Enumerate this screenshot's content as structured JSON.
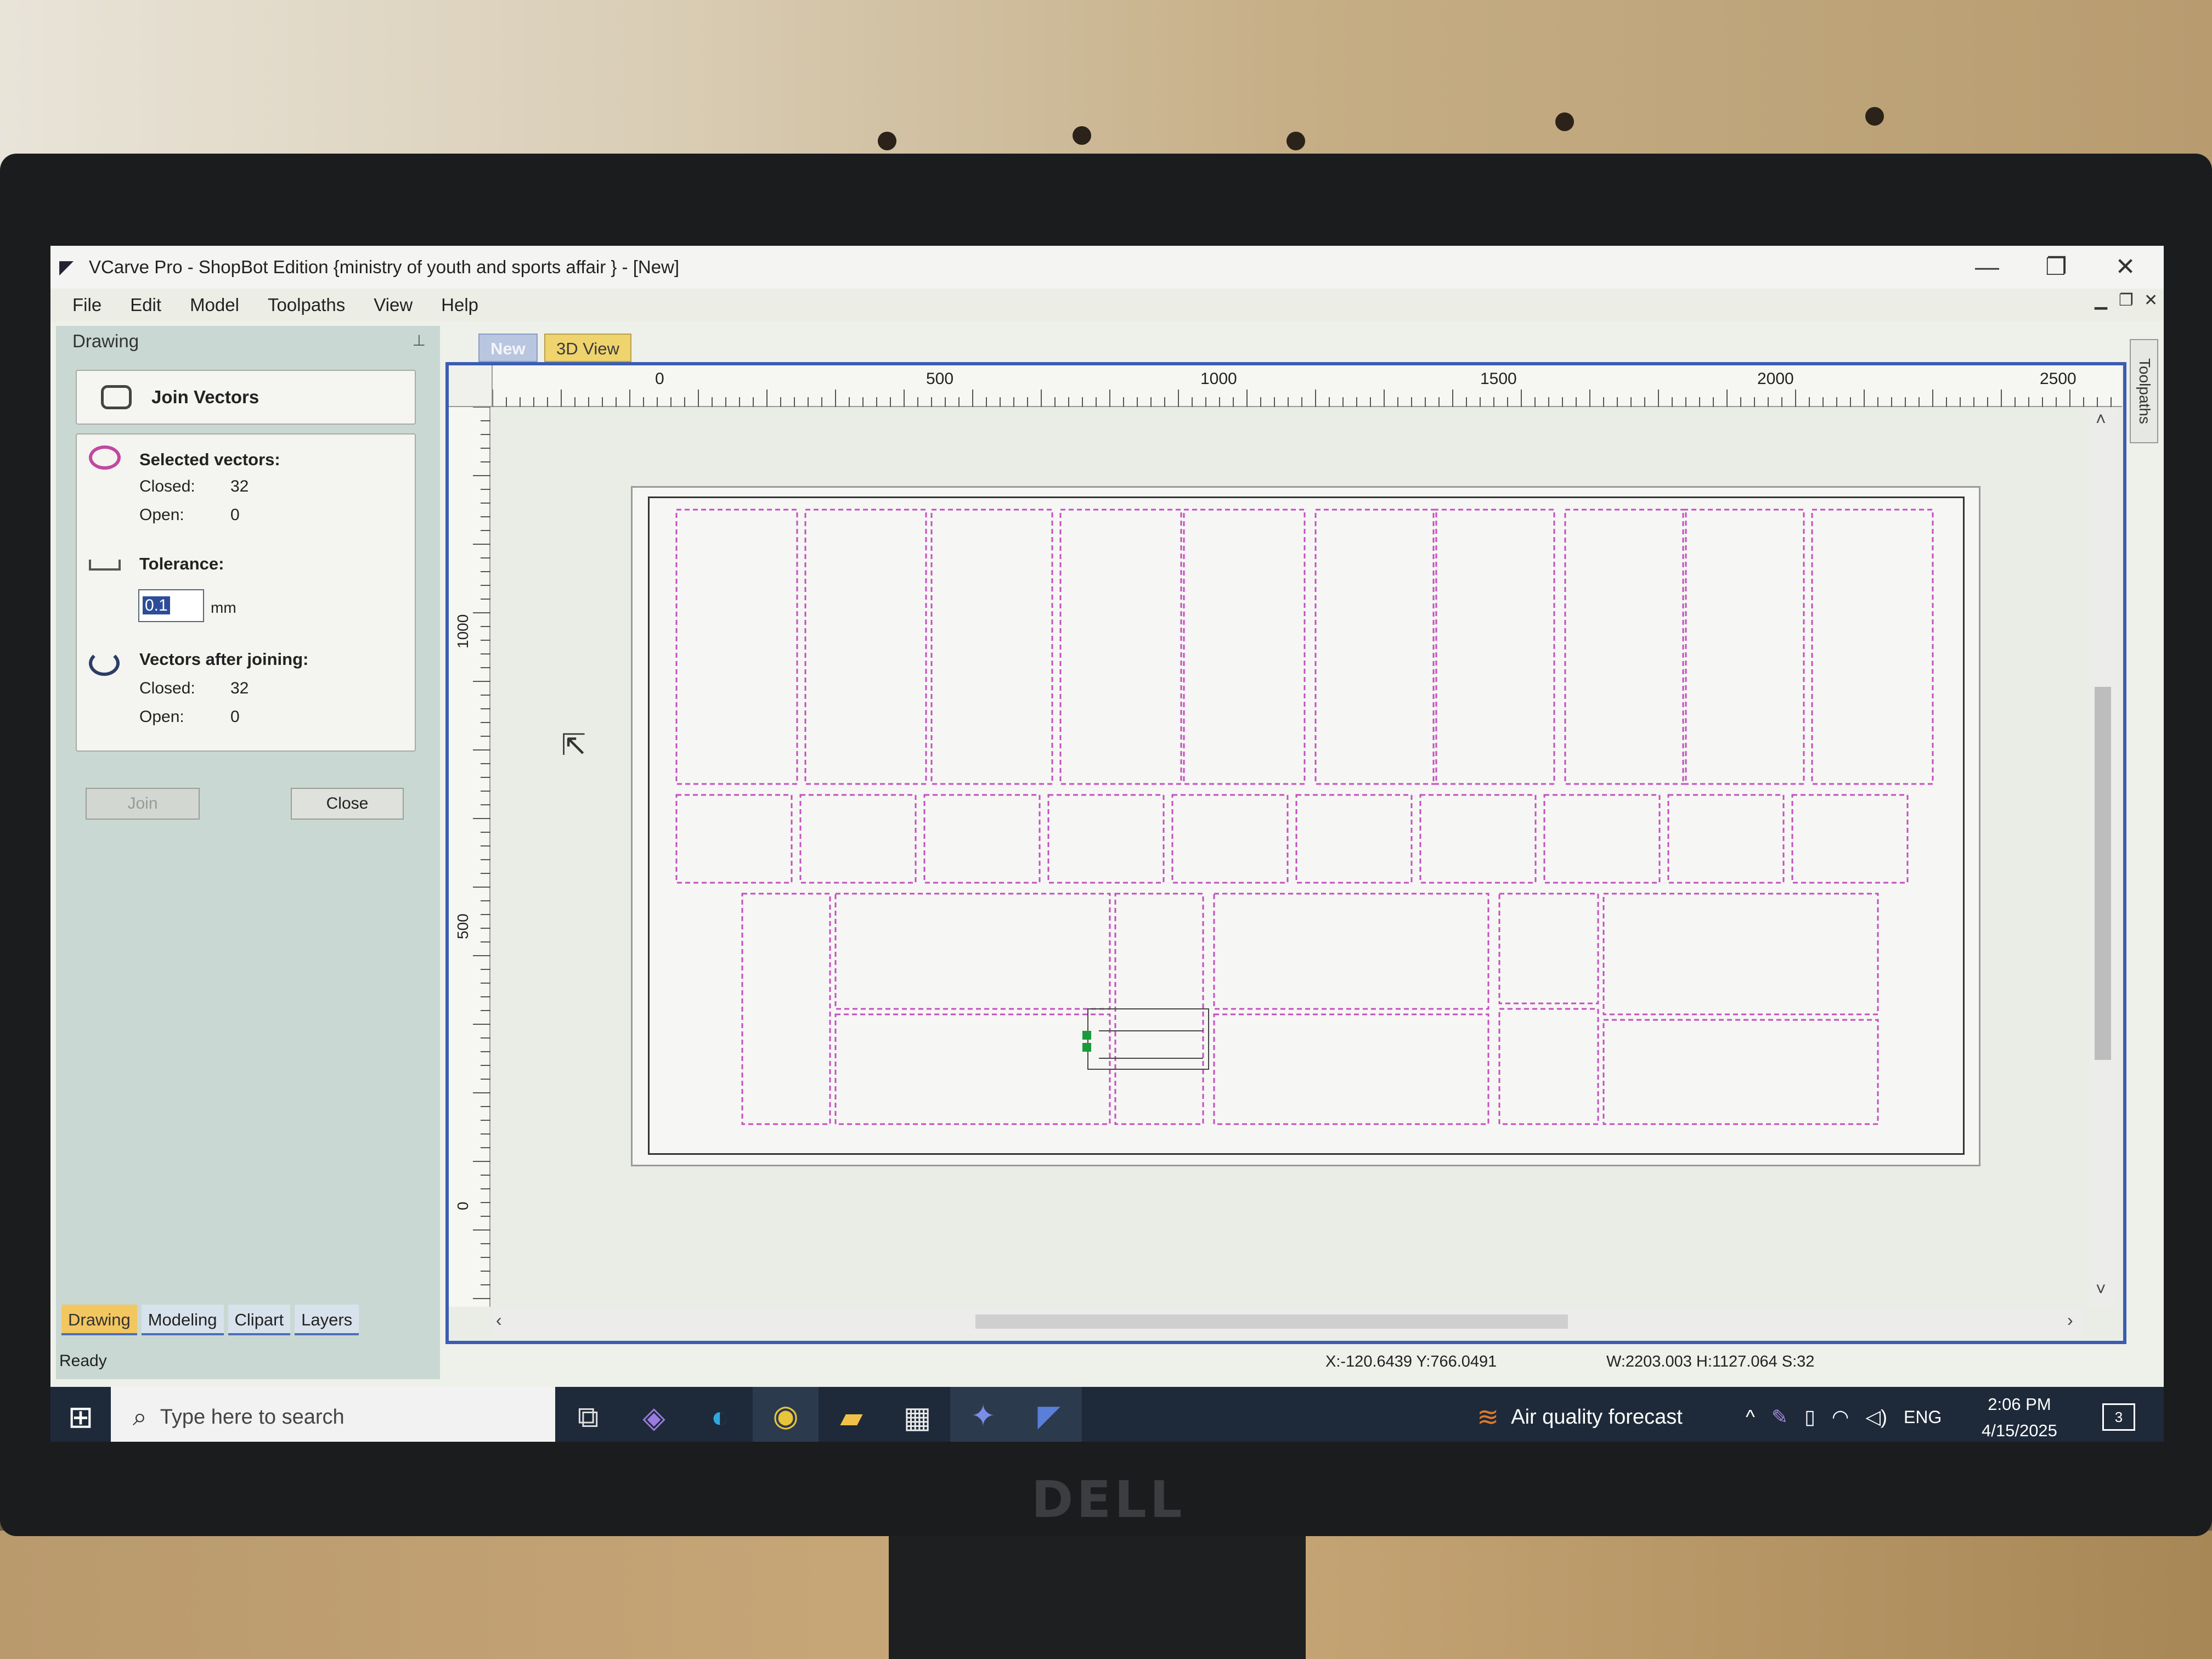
{
  "window": {
    "title": "VCarve Pro - ShopBot Edition {ministry of youth and sports affair } - [New]",
    "minimize_glyph": "—",
    "restore_glyph": "❐",
    "close_glyph": "✕"
  },
  "menu": [
    "File",
    "Edit",
    "Model",
    "Toolpaths",
    "View",
    "Help"
  ],
  "panel": {
    "header": "Drawing",
    "pin_glyph": "⊥",
    "tool_title": "Join Vectors",
    "selected_title": "Selected vectors:",
    "closed_label": "Closed:",
    "open_label": "Open:",
    "selected_closed": "32",
    "selected_open": "0",
    "tolerance_title": "Tolerance:",
    "tolerance_value": "0.1",
    "tolerance_unit": "mm",
    "after_title": "Vectors after joining:",
    "after_closed": "32",
    "after_open": "0",
    "join_button": "Join",
    "close_button": "Close"
  },
  "bottom_tabs": [
    "Drawing",
    "Modeling",
    "Clipart",
    "Layers"
  ],
  "view_tabs": {
    "new": "New",
    "view3d": "3D View"
  },
  "side_tab": "Toolpaths",
  "ruler": {
    "top_labels": [
      "0",
      "500",
      "1000",
      "1500",
      "2000",
      "2500"
    ],
    "left_labels": [
      "1000",
      "500",
      "0"
    ]
  },
  "status": {
    "ready": "Ready",
    "coords": "X:-120.6439 Y:766.0491",
    "dims": "W:2203.003   H:1127.064  S:32"
  },
  "taskbar": {
    "search_placeholder": "Type here to search",
    "weather": "Air quality forecast",
    "lang": "ENG",
    "time": "2:06 PM",
    "date": "4/15/2025",
    "notifications": "3"
  },
  "monitor_brand": "DELL",
  "colors": {
    "vector": "#c44fc0",
    "selection_green": "#1a9a3a",
    "accent": "#3a5cb3"
  }
}
